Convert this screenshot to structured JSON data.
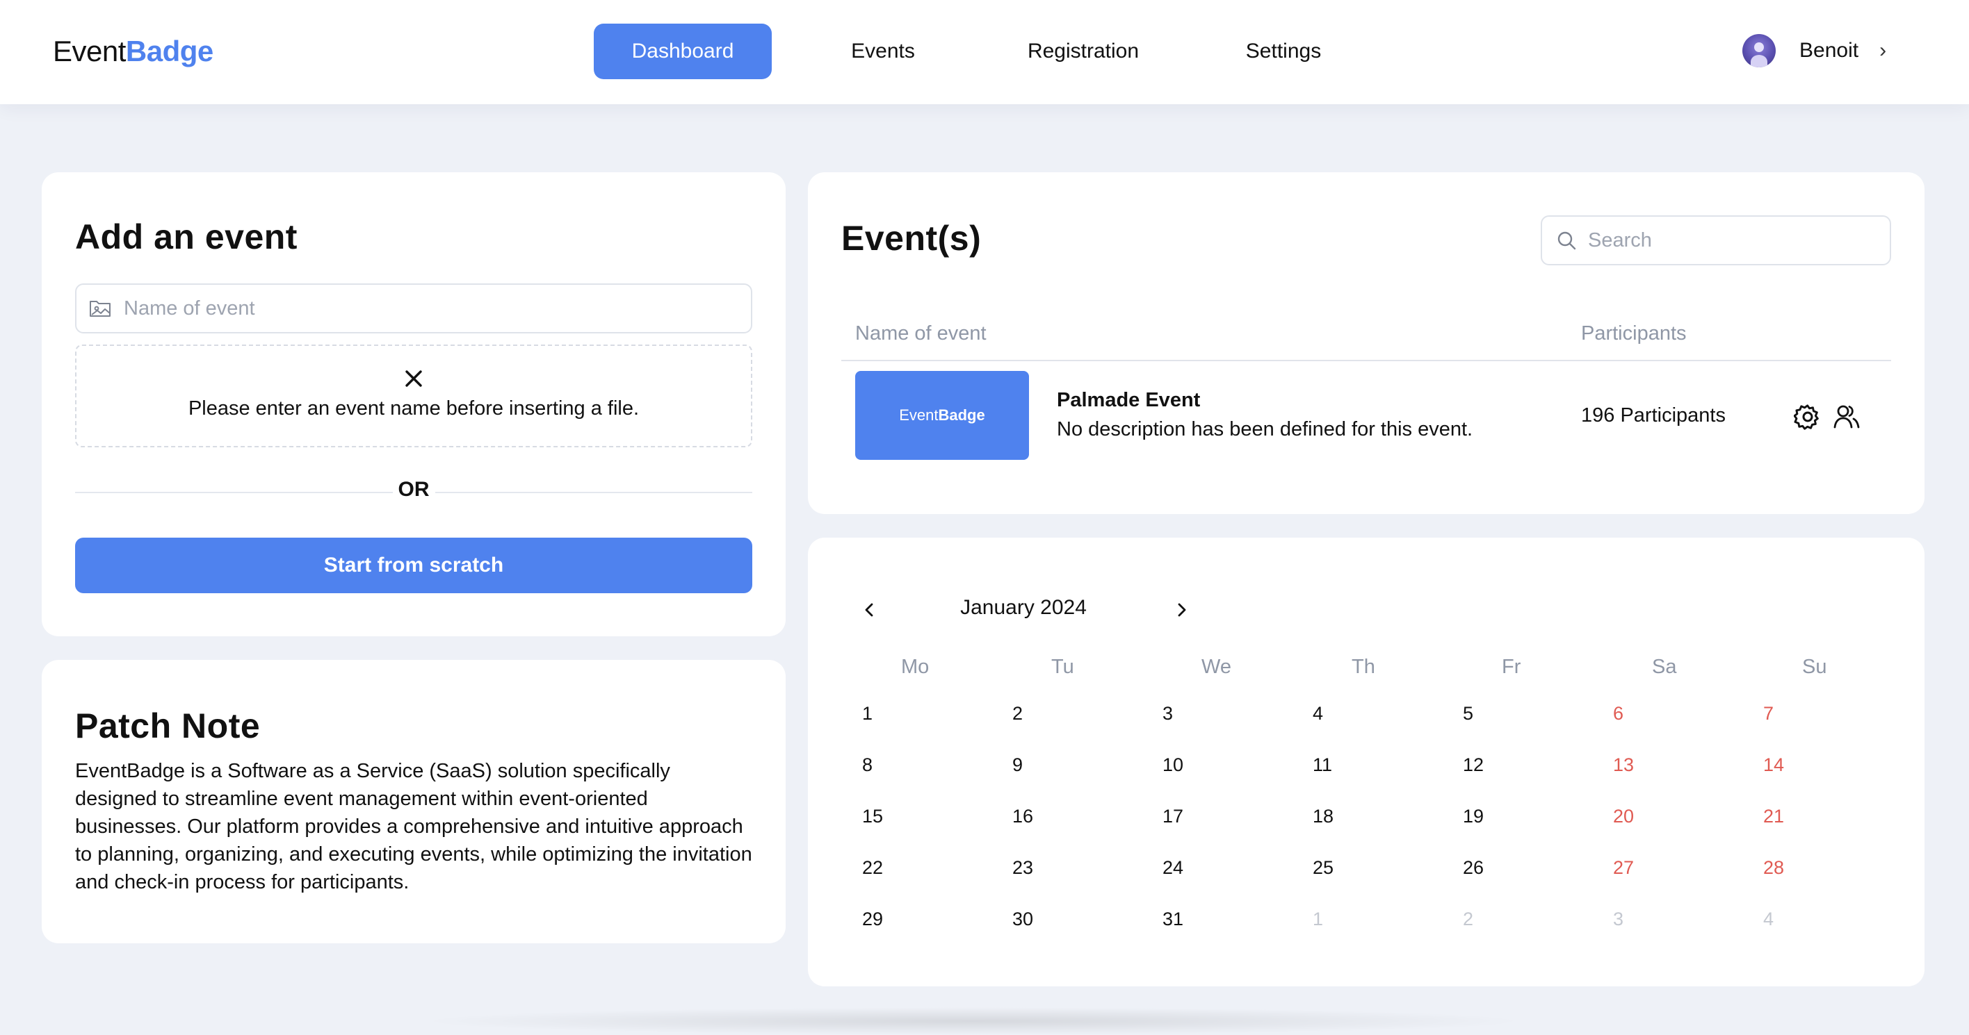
{
  "header": {
    "logo_part1": "Event",
    "logo_part2": "Badge",
    "nav": [
      {
        "label": "Dashboard",
        "active": true
      },
      {
        "label": "Events",
        "active": false
      },
      {
        "label": "Registration",
        "active": false
      },
      {
        "label": "Settings",
        "active": false
      }
    ],
    "user_name": "Benoit",
    "user_chevron": "›"
  },
  "add_event": {
    "title": "Add an event",
    "name_placeholder": "Name of event",
    "name_value": "",
    "dropzone_message": "Please enter an event name before inserting a file.",
    "or_label": "OR",
    "start_button": "Start from scratch"
  },
  "patch_note": {
    "title": "Patch Note",
    "body": "EventBadge is a Software as a Service (SaaS) solution specifically designed to streamline event management within event-oriented businesses. Our platform provides a comprehensive and intuitive approach to planning, organizing, and executing events, while optimizing the invitation and check-in process for participants."
  },
  "events": {
    "title": "Event(s)",
    "search_placeholder": "Search",
    "search_value": "",
    "columns": [
      "Name of event",
      "Participants"
    ],
    "rows": [
      {
        "thumb_part1": "Event",
        "thumb_part2": "Badge",
        "name": "Palmade Event",
        "description": "No description has been defined for this event.",
        "participants": "196 Participants"
      }
    ],
    "icons": [
      "settings-gear-icon",
      "participants-icon"
    ]
  },
  "calendar": {
    "month_label": "January 2024",
    "weekdays": [
      "Mo",
      "Tu",
      "We",
      "Th",
      "Fr",
      "Sa",
      "Su"
    ],
    "weeks": [
      [
        "1",
        "2",
        "3",
        "4",
        "5",
        "6",
        "7"
      ],
      [
        "8",
        "9",
        "10",
        "11",
        "12",
        "13",
        "14"
      ],
      [
        "15",
        "16",
        "17",
        "18",
        "19",
        "20",
        "21"
      ],
      [
        "22",
        "23",
        "24",
        "25",
        "26",
        "27",
        "28"
      ],
      [
        "29",
        "30",
        "31",
        "1",
        "2",
        "3",
        "4"
      ]
    ],
    "outside_month_from_last_week_index": 3,
    "colors": {
      "weekend": "#e05a52",
      "muted": "#c4c8d0",
      "accent": "#4f82ee"
    }
  }
}
